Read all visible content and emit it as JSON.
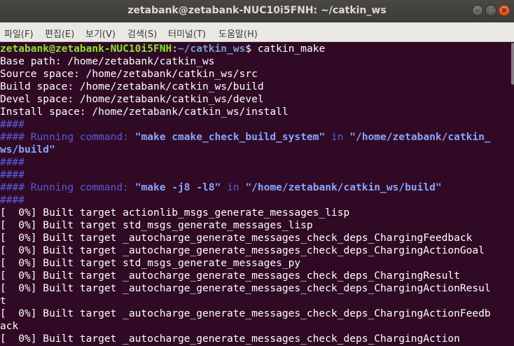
{
  "colors": {
    "terminal_bg": "#300a24",
    "prompt_user": "#8ae234",
    "prompt_path": "#729fcf",
    "foreground": "#ffffff",
    "hash_blue": "#5c5ce6",
    "running_text": "#5a5adb",
    "bold_command": "#8aa4ff",
    "titlebar": "#3c3b37",
    "menubar": "#eae8e4"
  },
  "window": {
    "title": "zetabank@zetabank-NUC10i5FNH: ~/catkin_ws",
    "buttons": {
      "minimize": "–",
      "maximize": "□",
      "close": "×"
    }
  },
  "menu": [
    "파일(F)",
    "편집(E)",
    "보기(V)",
    "검색(S)",
    "터미널(T)",
    "도움말(H)"
  ],
  "terminal": {
    "prompt": {
      "user_host": "zetabank@zetabank-NUC10i5FNH",
      "colon": ":",
      "path": "~/catkin_ws",
      "symbol": "$ ",
      "command": "catkin_make"
    },
    "lines": [
      [
        {
          "text": "Base path: /home/zetabank/catkin_ws",
          "style": "plain"
        }
      ],
      [
        {
          "text": "Source space: /home/zetabank/catkin_ws/src",
          "style": "plain"
        }
      ],
      [
        {
          "text": "Build space: /home/zetabank/catkin_ws/build",
          "style": "plain"
        }
      ],
      [
        {
          "text": "Devel space: /home/zetabank/catkin_ws/devel",
          "style": "plain"
        }
      ],
      [
        {
          "text": "Install space: /home/zetabank/catkin_ws/install",
          "style": "plain"
        }
      ],
      [
        {
          "text": "####",
          "style": "hash"
        }
      ],
      [
        {
          "text": "#### Running command: ",
          "style": "running"
        },
        {
          "text": "\"make cmake_check_build_system\"",
          "style": "bold"
        },
        {
          "text": " in ",
          "style": "running"
        },
        {
          "text": "\"/home/zetabank/catkin_",
          "style": "bold"
        }
      ],
      [
        {
          "text": "ws/build\"",
          "style": "bold"
        }
      ],
      [
        {
          "text": "####",
          "style": "hash"
        }
      ],
      [
        {
          "text": "####",
          "style": "hash"
        }
      ],
      [
        {
          "text": "#### Running command: ",
          "style": "running"
        },
        {
          "text": "\"make -j8 -l8\"",
          "style": "bold"
        },
        {
          "text": " in ",
          "style": "running"
        },
        {
          "text": "\"/home/zetabank/catkin_ws/build\"",
          "style": "bold"
        }
      ],
      [
        {
          "text": "####",
          "style": "hash"
        }
      ],
      [
        {
          "text": "[  0%] Built target actionlib_msgs_generate_messages_lisp",
          "style": "plain"
        }
      ],
      [
        {
          "text": "[  0%] Built target std_msgs_generate_messages_lisp",
          "style": "plain"
        }
      ],
      [
        {
          "text": "[  0%] Built target _autocharge_generate_messages_check_deps_ChargingFeedback",
          "style": "plain"
        }
      ],
      [
        {
          "text": "[  0%] Built target _autocharge_generate_messages_check_deps_ChargingActionGoal",
          "style": "plain"
        }
      ],
      [
        {
          "text": "[  0%] Built target std_msgs_generate_messages_py",
          "style": "plain"
        }
      ],
      [
        {
          "text": "[  0%] Built target _autocharge_generate_messages_check_deps_ChargingResult",
          "style": "plain"
        }
      ],
      [
        {
          "text": "[  0%] Built target _autocharge_generate_messages_check_deps_ChargingActionResul",
          "style": "plain"
        }
      ],
      [
        {
          "text": "t",
          "style": "plain"
        }
      ],
      [
        {
          "text": "[  0%] Built target _autocharge_generate_messages_check_deps_ChargingActionFeedb",
          "style": "plain"
        }
      ],
      [
        {
          "text": "ack",
          "style": "plain"
        }
      ],
      [
        {
          "text": "[  0%] Built target _autocharge_generate_messages_check_deps_ChargingAction",
          "style": "plain"
        }
      ]
    ]
  }
}
